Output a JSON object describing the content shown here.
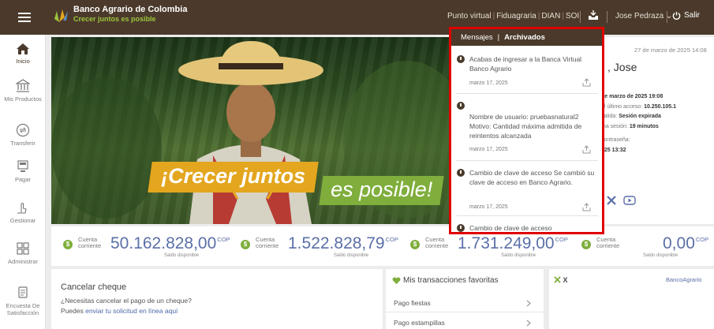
{
  "colors": {
    "brand": "#4b3a2b",
    "green": "#7fae3c",
    "gold": "#e3a61e",
    "amount": "#5b6fa8",
    "highlight": "#e00000"
  },
  "header": {
    "bank_name": "Banco Agrario de Colombia",
    "tagline": "Crecer juntos es posible",
    "nav_links": [
      "Punto virtual",
      "Fiduagraria",
      "DIAN",
      "SOI"
    ],
    "tray_icon": "tray-icon",
    "user_name": "Jose Pedraza",
    "exit_label": "Salir"
  },
  "sidebar": {
    "items": [
      {
        "label": "Inicio",
        "icon": "home-icon",
        "active": true
      },
      {
        "label": "Mis Productos",
        "icon": "bank-icon"
      },
      {
        "label": "Transferir",
        "icon": "transfer-icon"
      },
      {
        "label": "Pagar",
        "icon": "pay-icon"
      },
      {
        "label": "Gestionar",
        "icon": "manage-icon"
      },
      {
        "label": "Administrar",
        "icon": "grid-icon"
      },
      {
        "label": "Encuesta De Satisfacción",
        "icon": "survey-icon"
      }
    ]
  },
  "hero": {
    "slogan_line1": "¡Crecer juntos",
    "slogan_line2": "es posible!"
  },
  "user_panel": {
    "date": "27 de marzo de 2025 14:08",
    "greeting_partial": ", Jose",
    "info_lines": [
      {
        "label": "",
        "value": "de marzo de 2025 19:08"
      },
      {
        "label": "el último acceso:",
        "value": "10.250.105.1"
      },
      {
        "label": "salida:",
        "value": "Sesión expirada"
      },
      {
        "label": "ma sesión:",
        "value": "19 minutos"
      },
      {
        "label": "contraseña:",
        "value": ""
      },
      {
        "label": "",
        "value": "025 13:32"
      }
    ]
  },
  "messages_popup": {
    "tab_messages": "Mensajes",
    "tab_separator": "|",
    "tab_archived": "Archivados",
    "items": [
      {
        "text": "Acabas de ingresar a la Banca Virtual Banco Agrario",
        "date": "marzo 17, 2025"
      },
      {
        "text": "Nombre de usuario: pruebasnatural2 Motivo: Cantidad máxima admitida de reintentos alcanzada",
        "date": "marzo 17, 2025"
      },
      {
        "text": "Cambio de clave de acceso Se cambió su clave de acceso en Banco Agrario.",
        "date": "marzo 17, 2025"
      },
      {
        "text": "Cambio de clave de acceso",
        "date": ""
      }
    ]
  },
  "balances": [
    {
      "type": "Cuenta corriente",
      "amount": "50.162.828,00",
      "currency": "COP",
      "label": "Saldo disponible"
    },
    {
      "type": "Cuenta corriente",
      "amount": "1.522.828,79",
      "currency": "COP",
      "label": "Saldo disponible"
    },
    {
      "type": "Cuenta corriente",
      "amount": "1.731.249,00",
      "currency": "COP",
      "label": "Saldo disponible"
    },
    {
      "type": "Cuenta corriente",
      "amount": "0,00",
      "currency": "COP",
      "label": "Saldo disponible"
    }
  ],
  "cheque": {
    "title": "Cancelar cheque",
    "question": "¿Necesitas cancelar el pago de un cheque?",
    "line_prefix": "Puedes",
    "link": "enviar tu solicitud en línea aquí"
  },
  "favorites": {
    "title": "Mis transacciones favoritas",
    "items": [
      "Pago fiestas",
      "Pago estampillas"
    ]
  },
  "x_feed": {
    "title": "X",
    "handle": "BancoAgrario"
  }
}
